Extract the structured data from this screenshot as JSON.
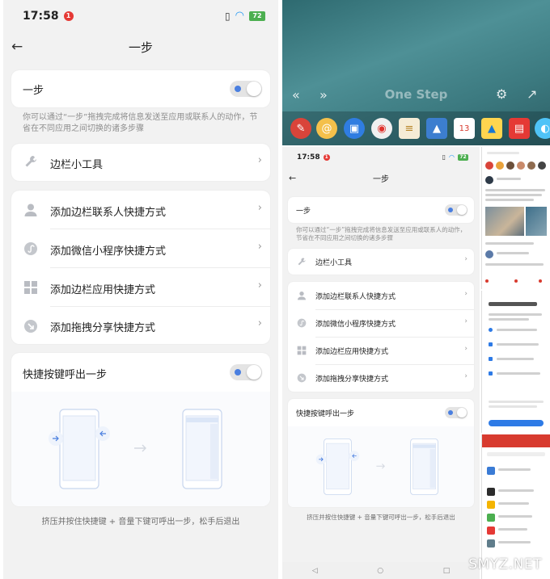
{
  "status": {
    "time": "17:58",
    "alert": "1",
    "battery": "72"
  },
  "header": {
    "title": "一步"
  },
  "onestep_card": {
    "label": "一步",
    "description": "你可以通过“一步”拖拽完成将信息发送至应用或联系人的动作，节省在不同应用之间切换的诸多步骤"
  },
  "sidebar_tools": {
    "label": "边栏小工具"
  },
  "shortcut_items": [
    {
      "label": "添加边栏联系人快捷方式",
      "icon": "contact-icon"
    },
    {
      "label": "添加微信小程序快捷方式",
      "icon": "mini-program-icon"
    },
    {
      "label": "添加边栏应用快捷方式",
      "icon": "grid-icon"
    },
    {
      "label": "添加拖拽分享快捷方式",
      "icon": "share-icon"
    }
  ],
  "hotkey_card": {
    "label": "快捷按键呼出一步",
    "footnote": "挤压并按住快捷键 + 音量下键可呼出一步，松手后退出"
  },
  "onestep_bar": {
    "label": "One Step"
  },
  "watermark": "SMYZ.NET",
  "colors": {
    "accent": "#4a7fe0",
    "background": "#f2f2f2",
    "card": "#ffffff",
    "alert": "#e53935",
    "battery": "#4caf50"
  }
}
